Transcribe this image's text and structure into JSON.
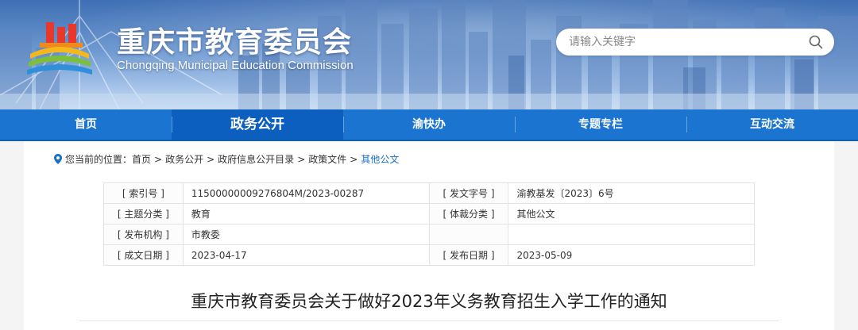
{
  "header": {
    "title_cn": "重庆市教育委员会",
    "title_en": "Chongqing Municipal Education Commission",
    "search": {
      "placeholder": "请输入关键字"
    }
  },
  "nav": {
    "items": [
      {
        "label": "首页"
      },
      {
        "label": "政务公开",
        "active": true
      },
      {
        "label": "渝快办"
      },
      {
        "label": "专题专栏"
      },
      {
        "label": "互动交流"
      }
    ]
  },
  "breadcrumb": {
    "prefix": "您当前的位置：",
    "items": [
      "首页",
      "政务公开",
      "政府信息公开目录",
      "政策文件",
      "其他公文"
    ],
    "separator": ">"
  },
  "meta": {
    "index_label": "[ 索引号 ]",
    "index_value": "11500000009276804M/2023-00287",
    "doc_no_label": "[ 发文字号 ]",
    "doc_no_value": "渝教基发〔2023〕6号",
    "topic_label": "[ 主题分类 ]",
    "topic_value": "教育",
    "genre_label": "[ 体裁分类 ]",
    "genre_value": "其他公文",
    "org_label": "[ 发布机构 ]",
    "org_value": "市教委",
    "created_label": "[ 成文日期 ]",
    "created_value": "2023-04-17",
    "published_label": "[ 发布日期 ]",
    "published_value": "2023-05-09"
  },
  "article": {
    "title": "重庆市教育委员会关于做好2023年义务教育招生入学工作的通知"
  },
  "colors": {
    "nav_bg": "#1a74d0",
    "nav_active": "#0d5fbf",
    "link_current": "#1a6fc6"
  }
}
